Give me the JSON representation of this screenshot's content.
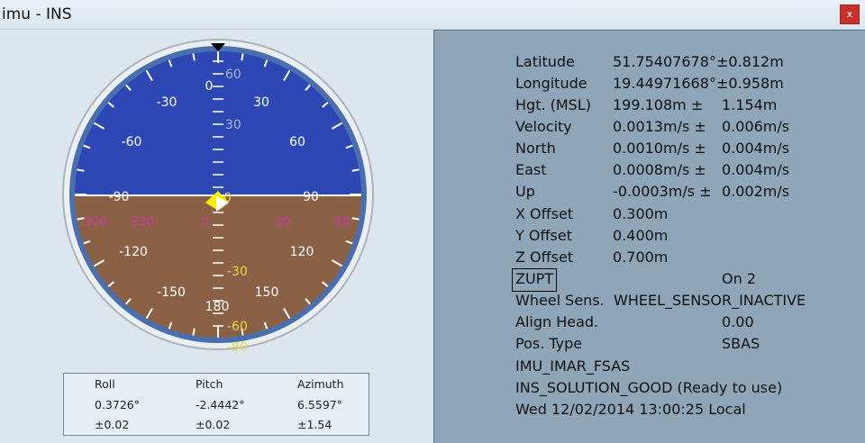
{
  "window": {
    "title": "imu - INS",
    "close_label": "x"
  },
  "gauge": {
    "roll_labels": [
      "-30",
      "30",
      "-60",
      "60",
      "-90",
      "90",
      "-120",
      "120",
      "-150",
      "150",
      "180",
      "0"
    ],
    "pitch_labels": [
      "60",
      "30",
      "-30",
      "-60",
      "-90",
      "0"
    ],
    "heading_labels": [
      "300",
      "330",
      "0",
      "30",
      "60"
    ],
    "colors": {
      "sky": "#2d48b5",
      "ground": "#8b6146",
      "ring": "#4a6fae",
      "heading": "#c83aa3",
      "pitch_neg": "#e8d64a",
      "marker": "#f3ef00"
    }
  },
  "attitude": {
    "headers": [
      "Roll",
      "Pitch",
      "Azimuth"
    ],
    "values": [
      "0.3726°",
      "-2.4442°",
      "6.5597°"
    ],
    "errors": [
      "±0.02",
      "±0.02",
      "±1.54"
    ]
  },
  "info": {
    "lat_label": "Latitude",
    "lat_value": "51.75407678°",
    "lat_err": "±0.812m",
    "lon_label": "Longitude",
    "lon_value": "19.44971668°",
    "lon_err": "±0.958m",
    "hgt_label": "Hgt. (MSL)",
    "hgt_value": "199.108m ±",
    "hgt_err": "1.154m",
    "vel_label": "Velocity",
    "vel_value": "0.0013m/s ±",
    "vel_err": "0.006m/s",
    "north_label": "North",
    "north_value": "0.0010m/s ±",
    "north_err": "0.004m/s",
    "east_label": "East",
    "east_value": "0.0008m/s ±",
    "east_err": "0.004m/s",
    "up_label": "Up",
    "up_value": "-0.0003m/s ±",
    "up_err": "0.002m/s",
    "xoff_label": "X Offset",
    "xoff_value": "0.300m",
    "yoff_label": "Y Offset",
    "yoff_value": "0.400m",
    "zoff_label": "Z Offset",
    "zoff_value": "0.700m",
    "zupt_label": "ZUPT",
    "zupt_value": "On 2",
    "wheel_label": "Wheel Sens.",
    "wheel_value": "WHEEL_SENSOR_INACTIVE",
    "align_label": "Align Head.",
    "align_value": "0.00",
    "pos_label": "Pos. Type",
    "pos_value": "SBAS",
    "imu_type": "IMU_IMAR_FSAS",
    "ins_status": "INS_SOLUTION_GOOD (Ready to use)",
    "datetime": "Wed 12/02/2014 13:00:25 Local"
  }
}
